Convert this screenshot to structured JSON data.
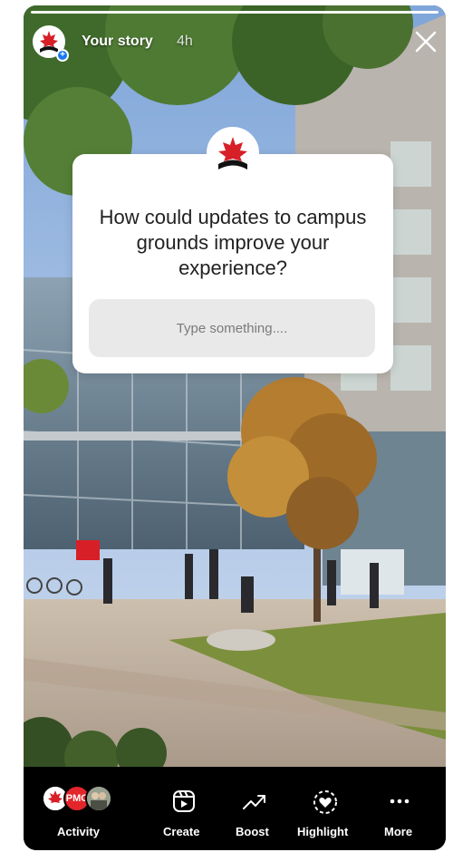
{
  "story": {
    "user": "Your story",
    "age": "4h"
  },
  "question": {
    "text": "How could updates to campus grounds improve your experience?",
    "placeholder": "Type something...."
  },
  "bottom_bar": {
    "activity_label": "Activity",
    "activity_badge": "PMC",
    "create_label": "Create",
    "boost_label": "Boost",
    "highlight_label": "Highlight",
    "more_label": "More"
  },
  "colors": {
    "brand_red": "#d71f27",
    "bar_background": "#000000",
    "card_background": "#ffffff"
  },
  "icons": {
    "close": "close-icon",
    "create": "reels-create-icon",
    "boost": "trend-up-icon",
    "highlight": "heart-circle-icon",
    "more": "ellipsis-icon"
  }
}
